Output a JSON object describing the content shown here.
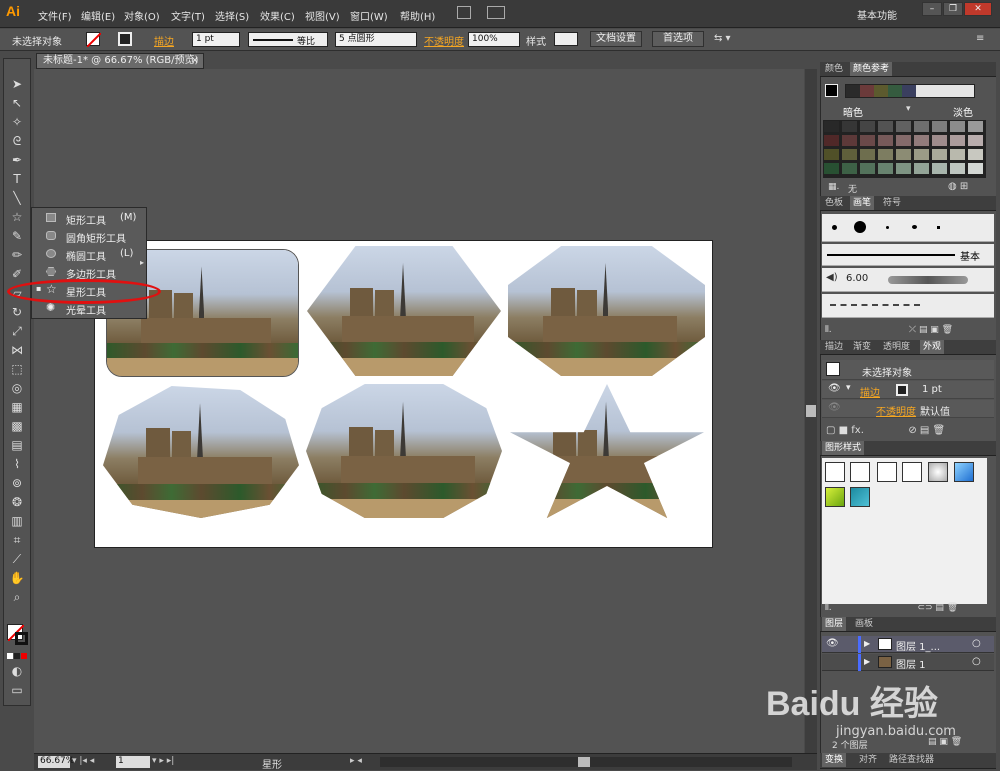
{
  "app": {
    "logo": "Ai",
    "workspace": "基本功能"
  },
  "menu": [
    "文件(F)",
    "编辑(E)",
    "对象(O)",
    "文字(T)",
    "选择(S)",
    "效果(C)",
    "视图(V)",
    "窗口(W)",
    "帮助(H)"
  ],
  "control": {
    "selection": "未选择对象",
    "stroke_label": "描边",
    "stroke_weight": "1 pt",
    "profile": "等比",
    "brush": "5 点圆形",
    "opacity_label": "不透明度",
    "opacity_value": "100%",
    "style_label": "样式",
    "doc_setup": "文档设置",
    "prefs": "首选项"
  },
  "document": {
    "tab": "未标题-1* @ 66.67% (RGB/预览)"
  },
  "flyout": [
    {
      "label": "矩形工具",
      "key": "(M)"
    },
    {
      "label": "圆角矩形工具",
      "key": ""
    },
    {
      "label": "椭圆工具",
      "key": "(L)"
    },
    {
      "label": "多边形工具",
      "key": ""
    },
    {
      "label": "星形工具",
      "key": ""
    },
    {
      "label": "光晕工具",
      "key": ""
    }
  ],
  "status": {
    "zoom": "66.67%",
    "page": "1",
    "tool": "星形"
  },
  "panels": {
    "color_tabs": [
      "颜色",
      "颜色参考"
    ],
    "color_ref": {
      "dark": "暗色",
      "light": "淡色",
      "none": "无"
    },
    "brush_tabs": [
      "色板",
      "画笔",
      "符号"
    ],
    "brush_basic": "基本",
    "brush_size": "6.00",
    "appearance_tabs": [
      "描边",
      "渐变",
      "透明度",
      "外观"
    ],
    "appearance": {
      "title": "未选择对象",
      "stroke": "描边",
      "stroke_value": "1 pt",
      "opacity": "不透明度",
      "opacity_value": "默认值"
    },
    "graphic_styles": "图形样式",
    "layers_tabs": [
      "图层",
      "画板"
    ],
    "layers": [
      {
        "name": "图层 1_..."
      },
      {
        "name": "图层 1"
      }
    ],
    "layers_footer": "2 个图层",
    "bottom_tabs": [
      "变换",
      "对齐",
      "路径查找器"
    ]
  },
  "watermark": {
    "main": "Baidu 经验",
    "sub": "jingyan.baidu.com"
  },
  "colors": {
    "accent": "#f5a623",
    "highlight": "#e01010"
  }
}
